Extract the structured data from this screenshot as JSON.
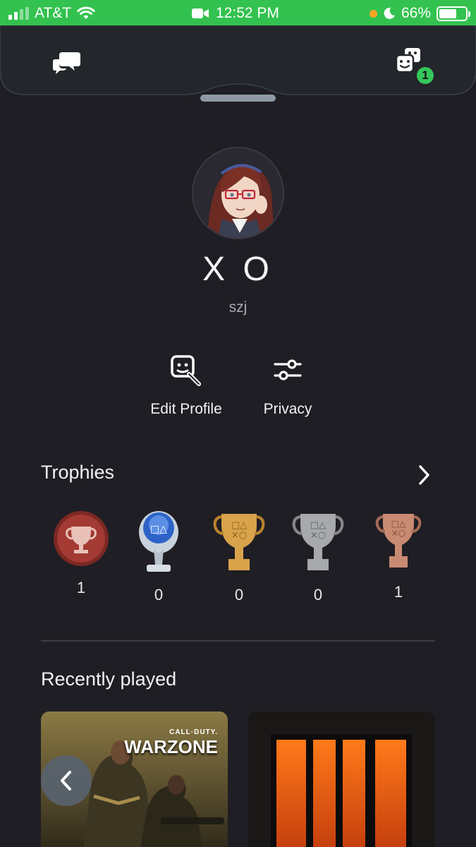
{
  "status_bar": {
    "carrier": "AT&T",
    "time": "12:52 PM",
    "battery_text": "66%",
    "battery_level": 0.66,
    "background_color": "#33c24f",
    "icons": [
      "signal-icon",
      "wifi-icon",
      "video-camera-icon",
      "orange-dot-icon",
      "moon-icon",
      "battery-icon"
    ]
  },
  "top_bar": {
    "chat_icon": "chat-bubbles-icon",
    "games_icon": "game-dice-icon",
    "games_badge": "1",
    "badge_color": "#35c75a"
  },
  "profile": {
    "display_name": "X O",
    "username": "szj",
    "avatar_icon": "anime-avatar-image"
  },
  "actions": [
    {
      "label": "Edit Profile",
      "icon": "edit-profile-icon"
    },
    {
      "label": "Privacy",
      "icon": "sliders-icon"
    }
  ],
  "trophies": {
    "title": "Trophies",
    "items": [
      {
        "type": "level",
        "count": "1",
        "color": "#a33a33"
      },
      {
        "type": "platinum",
        "count": "0",
        "color": "#c9d3dc"
      },
      {
        "type": "gold",
        "count": "0",
        "color": "#d8a34a"
      },
      {
        "type": "silver",
        "count": "0",
        "color": "#a7a9ad"
      },
      {
        "type": "bronze",
        "count": "1",
        "color": "#c98a73"
      }
    ]
  },
  "recently_played": {
    "title": "Recently played",
    "games": [
      {
        "name": "warzone-card",
        "logo_top": "CALL·DUTY.",
        "logo_main": "WARZONE"
      },
      {
        "name": "black-ops-card"
      }
    ]
  },
  "colors": {
    "background": "#1f1e24",
    "top_bar": "#23262b"
  }
}
